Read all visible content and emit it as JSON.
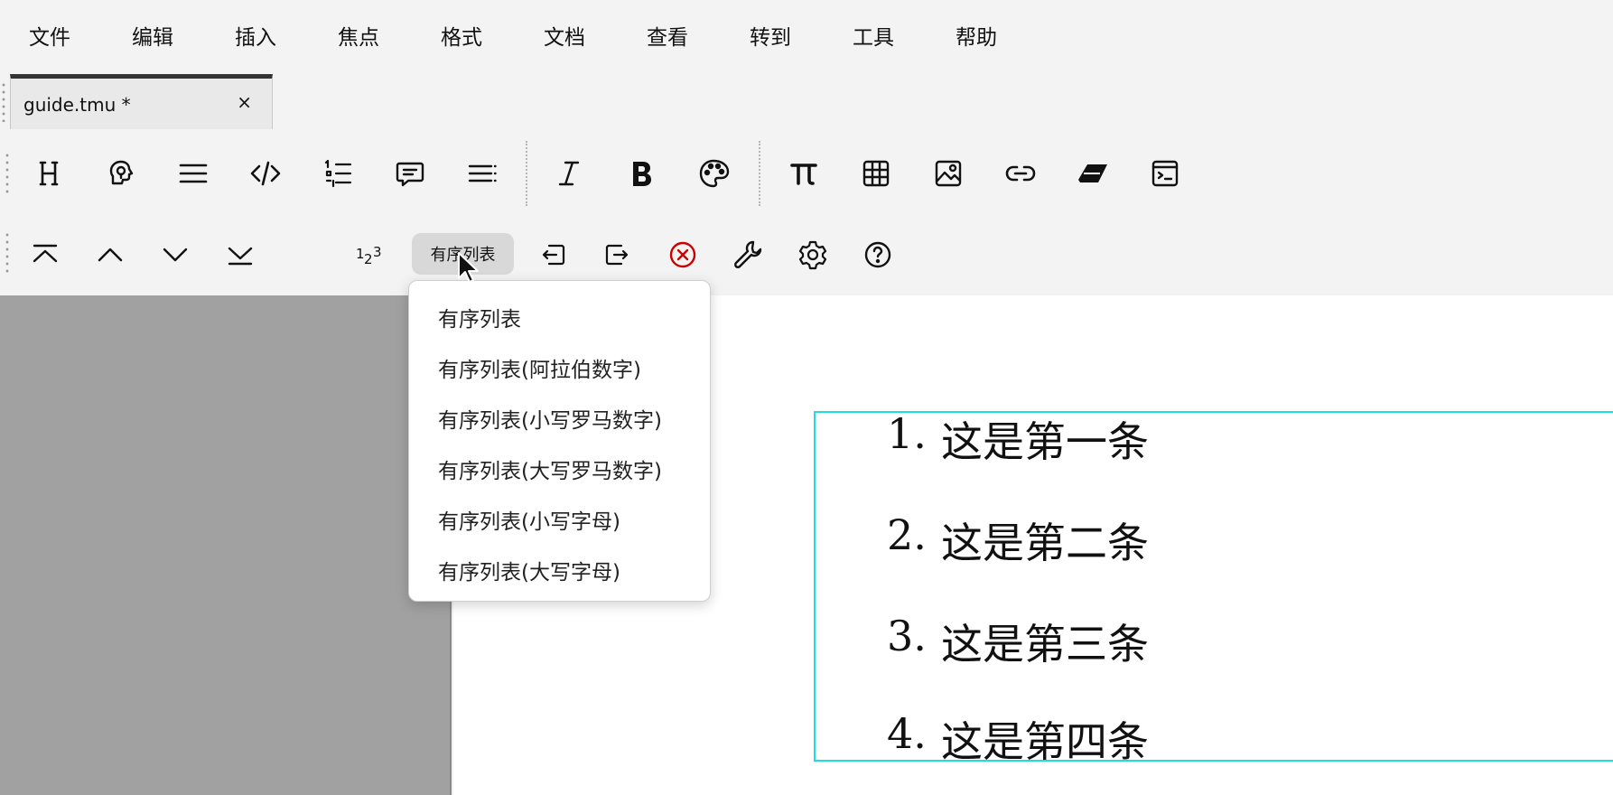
{
  "menubar": {
    "items": [
      "文件",
      "编辑",
      "插入",
      "焦点",
      "格式",
      "文档",
      "查看",
      "转到",
      "工具",
      "帮助"
    ]
  },
  "tab": {
    "title": "guide.tmu *",
    "close": "×"
  },
  "toolbar1": {
    "icons": [
      "heading-icon",
      "idea-bulb-icon",
      "paragraph-icon",
      "code-icon",
      "checklist-icon",
      "comment-icon",
      "list-icon",
      "italic-icon",
      "bold-icon",
      "palette-icon",
      "pi-icon",
      "table-icon",
      "image-icon",
      "link-icon",
      "eraser-icon",
      "terminal-icon"
    ]
  },
  "toolbar2": {
    "icons": [
      "move-top-icon",
      "move-up-icon",
      "move-down-icon",
      "move-bottom-icon",
      "numbered-list-icon",
      "outdent-icon",
      "indent-icon",
      "remove-icon",
      "wrench-icon",
      "gear-icon",
      "help-icon"
    ],
    "list_style_label": "有序列表",
    "accent_color": "#cc0000"
  },
  "dropdown": {
    "items": [
      "有序列表",
      "有序列表(阿拉伯数字)",
      "有序列表(小写罗马数字)",
      "有序列表(大写罗马数字)",
      "有序列表(小写字母)",
      "有序列表(大写字母)"
    ]
  },
  "editor": {
    "list": [
      {
        "num": "1.",
        "text": "这是第一条"
      },
      {
        "num": "2.",
        "text": "这是第二条"
      },
      {
        "num": "3.",
        "text": "这是第三条"
      },
      {
        "num": "4.",
        "text": "这是第四条"
      }
    ],
    "focus_color": "#1ddde0"
  }
}
